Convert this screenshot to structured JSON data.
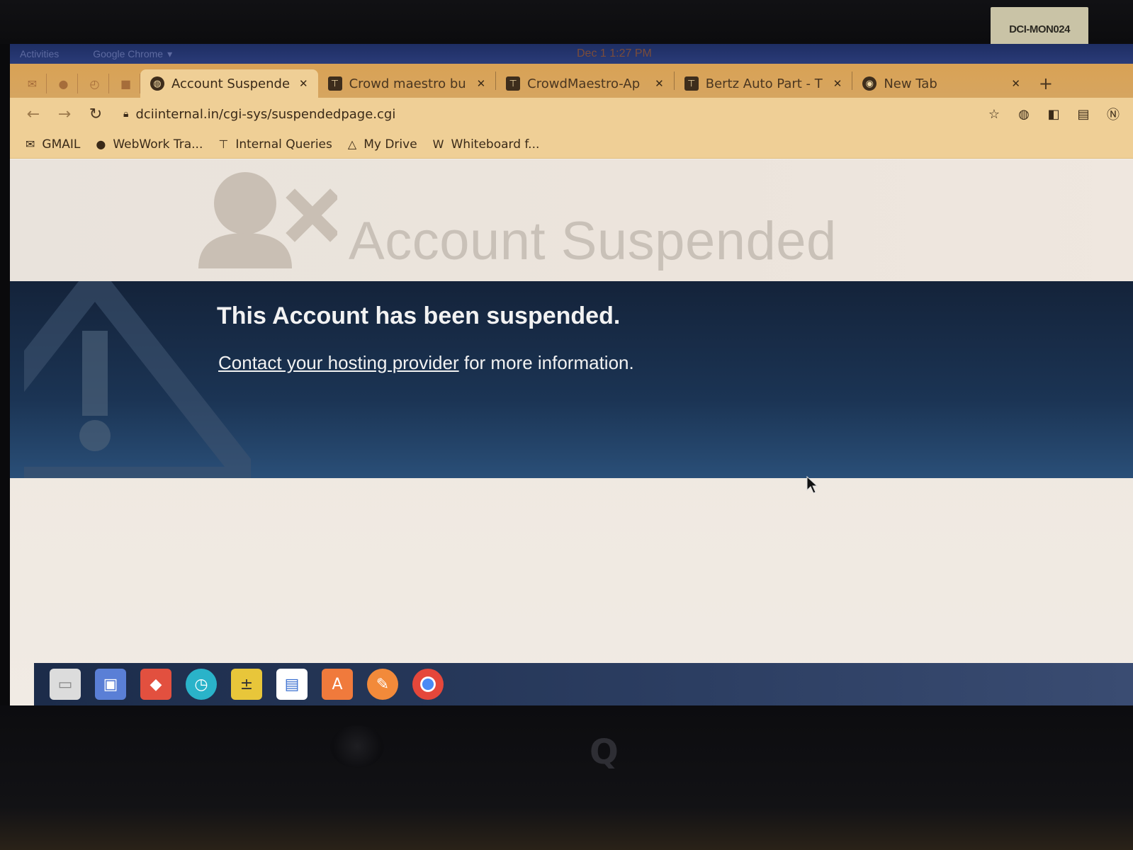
{
  "monitor": {
    "sticker": "DCI-MON024",
    "brand_logo": "Q"
  },
  "gnome": {
    "activities": "Activities",
    "app_menu": "Google Chrome",
    "clock": "Dec 1  1:27 PM"
  },
  "tabs": [
    {
      "title": "Account Suspende",
      "active": true,
      "icon": "globe-icon"
    },
    {
      "title": "Crowd maestro bu",
      "active": false,
      "icon": "crowdmaestro-icon"
    },
    {
      "title": "CrowdMaestro-Ap",
      "active": false,
      "icon": "crowdmaestro-icon"
    },
    {
      "title": "Bertz Auto Part - T",
      "active": false,
      "icon": "crowdmaestro-icon"
    },
    {
      "title": "New Tab",
      "active": false,
      "icon": "chrome-icon"
    }
  ],
  "toolbar": {
    "url": "dciinternal.in/cgi-sys/suspendedpage.cgi"
  },
  "bookmarks": [
    {
      "label": "GMAIL",
      "icon": "gmail-icon"
    },
    {
      "label": "WebWork Tra...",
      "icon": "webwork-icon"
    },
    {
      "label": "Internal Queries",
      "icon": "crowdmaestro-icon"
    },
    {
      "label": "My Drive",
      "icon": "drive-icon"
    },
    {
      "label": "Whiteboard f...",
      "icon": "whiteboard-icon"
    }
  ],
  "page": {
    "header_title": "Account Suspended",
    "heading": "This Account has been suspended.",
    "link_text": "Contact your hosting provider",
    "info_suffix": " for more information."
  },
  "colors": {
    "tab_strip": "#d9a255",
    "toolbar": "#efcf96",
    "banner_dark": "#14233a",
    "banner_light": "#2a4f78",
    "header_title": "#c9c1b8"
  }
}
